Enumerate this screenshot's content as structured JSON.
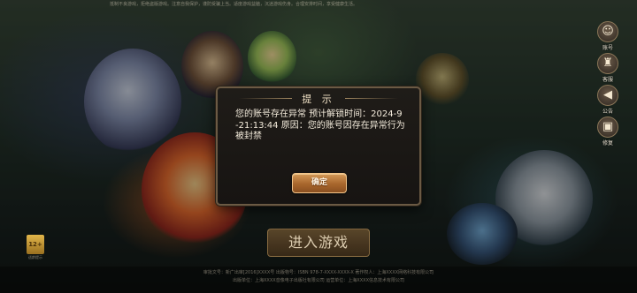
{
  "top_notice": "抵制不良游戏，拒绝盗版游戏。注意自我保护，谨防受骗上当。适度游戏益脑，沉迷游戏伤身。合理安排时间，享受健康生活。",
  "side_menu": [
    {
      "icon": "account-icon",
      "glyph": "☺",
      "label": "账号"
    },
    {
      "icon": "announcement-icon",
      "glyph": "♜",
      "label": "客服"
    },
    {
      "icon": "speaker-icon",
      "glyph": "◀",
      "label": "公告"
    },
    {
      "icon": "repair-icon",
      "glyph": "▣",
      "label": "修复"
    }
  ],
  "enter_button": "进入游戏",
  "age_badge": {
    "label": "12+",
    "caption": "适龄提示"
  },
  "footer": [
    "审批文号：新广出审[2016]XXXX号     出版物号：ISBN 978-7-XXXX-XXXX-X     著作权人：上海XXXX网络科技有限公司",
    "出版单位：上海XXXX音像电子出版社有限公司     运营单位：上海XXXX信息技术有限公司"
  ],
  "dialog": {
    "title": "提 示",
    "message": "您的账号存在异常 预计解锁时间：2024-9-21:13:44 原因：您的账号因存在异常行为被封禁",
    "confirm_label": "确定"
  },
  "colors": {
    "dialog_border": "#6b5a44",
    "button_top": "#d49a58",
    "button_bottom": "#8a4f20",
    "text_light": "#f4ecdc"
  }
}
